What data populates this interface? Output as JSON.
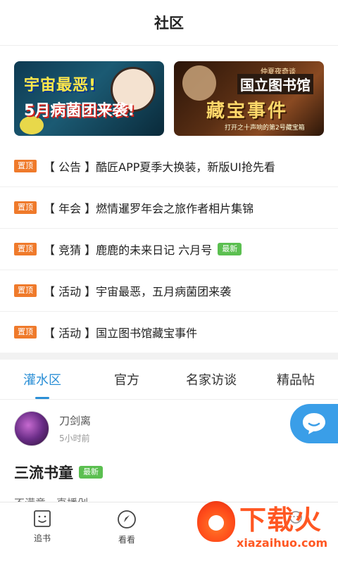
{
  "header": {
    "title": "社区"
  },
  "banners": [
    {
      "line1": "宇宙最恶!",
      "line2": "5月病菌团来袭!"
    },
    {
      "small": "仲夏夜奇谈",
      "line1": "国立图书馆",
      "line2": "藏宝事件",
      "sub": "打开之十声响的第2号藏宝箱"
    }
  ],
  "pin_label": "置顶",
  "new_label": "最新",
  "notices": [
    {
      "text": "【 公告 】酷匠APP夏季大换装，新版UI抢先看"
    },
    {
      "text": "【 年会 】燃情暹罗年会之旅作者相片集锦"
    },
    {
      "text": "【 竞猜 】鹿鹿的未来日记 六月号"
    },
    {
      "text": "【 活动 】宇宙最恶，五月病菌团来袭"
    },
    {
      "text": "【 活动 】国立图书馆藏宝事件"
    }
  ],
  "tabs": [
    "灌水区",
    "官方",
    "名家访谈",
    "精品帖"
  ],
  "active_tab": 0,
  "post": {
    "author": "刀剑离",
    "time": "5小时前",
    "title": "三流书童",
    "body": "不满意，直播剁"
  },
  "bottom_nav": [
    {
      "label": "追书",
      "icon": "face-box-icon"
    },
    {
      "label": "看看",
      "icon": "compass-icon"
    },
    {
      "label": "",
      "icon": "community-icon"
    },
    {
      "label": "",
      "icon": "profile-icon"
    }
  ],
  "watermark": {
    "text": "下载火",
    "url": "xiazaihuo.com"
  },
  "colors": {
    "accent": "#2b8fd6",
    "pin": "#ef7a2b",
    "new": "#5bbf50",
    "fab": "#3a9ee8",
    "watermark": "#ff5722"
  }
}
